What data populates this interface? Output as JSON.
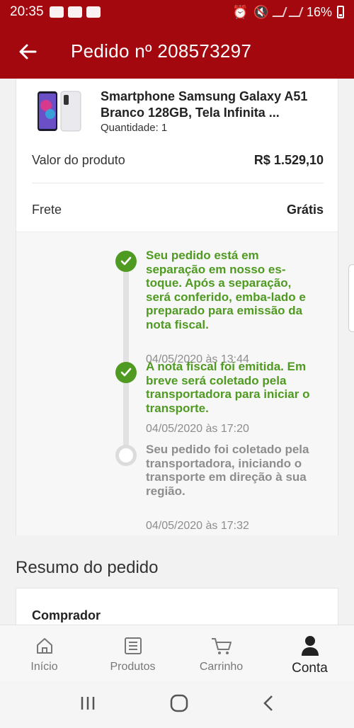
{
  "status_bar": {
    "time": "20:35",
    "battery": "16%"
  },
  "app_bar": {
    "title": "Pedido nº 208573297"
  },
  "product": {
    "name": "Smartphone Samsung Galaxy A51 Branco 128GB, Tela Infinita ...",
    "quantity": "Quantidade: 1"
  },
  "summary_rows": [
    {
      "label": "Valor do produto",
      "value": "R$ 1.529,10"
    },
    {
      "label": "Frete",
      "value": "Grátis"
    }
  ],
  "tracking": [
    {
      "status": "done",
      "text": "Seu pedido está em separação em nosso es-toque. Após a separação, será conferido, emba-lado e preparado para emissão da nota fiscal.",
      "date": "04/05/2020 às 13:44"
    },
    {
      "status": "done",
      "text": "A nota fiscal foi emitida. Em breve será coletado pela transportadora para iniciar o transporte.",
      "date": "04/05/2020 às 17:20"
    },
    {
      "status": "pending",
      "text": "Seu pedido foi coletado pela transportadora, iniciando o transporte em direção à sua região.",
      "date": "04/05/2020 às 17:32"
    }
  ],
  "resumo": {
    "title": "Resumo do pedido",
    "comprador_label": "Comprador"
  },
  "bottom_nav": [
    {
      "label": "Início",
      "icon": "home-icon"
    },
    {
      "label": "Produtos",
      "icon": "list-icon"
    },
    {
      "label": "Carrinho",
      "icon": "cart-icon"
    },
    {
      "label": "Conta",
      "icon": "user-icon",
      "active": true
    }
  ],
  "colors": {
    "brand": "#a3080f",
    "success": "#4f9a21",
    "muted": "#8d8d8d"
  }
}
